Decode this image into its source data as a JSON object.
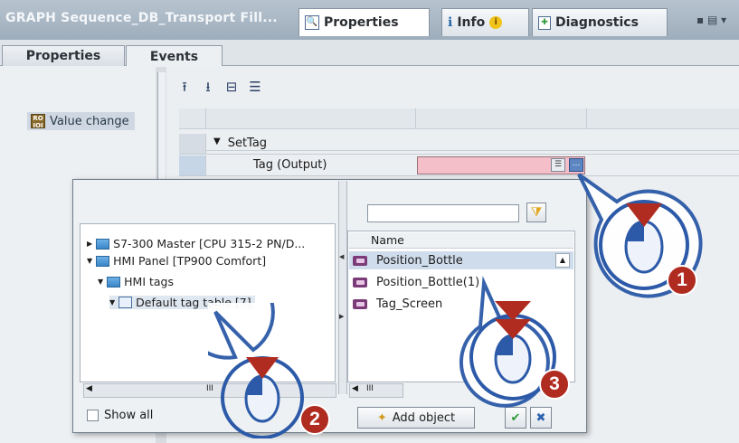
{
  "window": {
    "title": "GRAPH Sequence_DB_Transport Fill...",
    "tabs": [
      {
        "label": "Properties",
        "icon": "properties-icon"
      },
      {
        "label": "Info",
        "icon": "info-icon"
      },
      {
        "label": "Diagnostics",
        "icon": "diagnostics-icon"
      }
    ],
    "controls": "▪ ▤ ▾"
  },
  "subtabs": [
    {
      "label": "Properties"
    },
    {
      "label": "Events"
    }
  ],
  "events": {
    "selected": "Value change"
  },
  "grid": {
    "function_name": "SetTag",
    "param_label": "Tag (Output)"
  },
  "dialog": {
    "tree": [
      {
        "label": "S7-300 Master [CPU 315-2 PN/D...",
        "expanded": false
      },
      {
        "label": "HMI Panel [TP900 Comfort]",
        "expanded": true
      },
      {
        "label": "HMI tags",
        "expanded": true
      },
      {
        "label": "Default tag table [7]",
        "expanded": true
      }
    ],
    "list_header": "Name",
    "list_items": [
      "Position_Bottle",
      "Position_Bottle(1)",
      "Tag_Screen"
    ],
    "show_all_label": "Show all",
    "add_object_label": "Add object",
    "ok_symbol": "✔",
    "cancel_symbol": "✖",
    "scroll_marker": "III"
  },
  "callouts": [
    {
      "number": "1"
    },
    {
      "number": "2"
    },
    {
      "number": "3"
    }
  ],
  "colors": {
    "accent": "#5c86c2",
    "tag_value_bg": "#f4bfc9",
    "callout_badge": "#b02b20",
    "callout_ring": "#2c5aa8"
  }
}
